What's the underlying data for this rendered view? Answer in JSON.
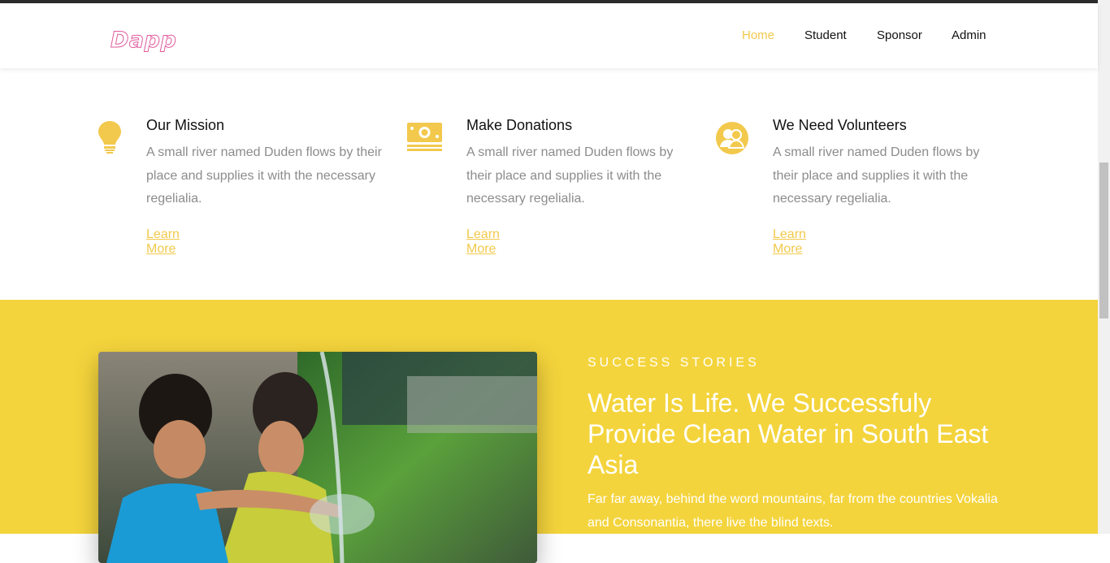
{
  "brand": {
    "logo": "Dapp"
  },
  "nav": {
    "items": [
      "Home",
      "Student",
      "Sponsor",
      "Admin"
    ],
    "active": "Home"
  },
  "colors": {
    "accent": "#f2c94c",
    "yellow_bg": "#f4d43c",
    "logo": "#e05b9d"
  },
  "features": [
    {
      "icon": "lightbulb-icon",
      "title": "Our Mission",
      "text": "A small river named Duden flows by their place and supplies it with the necessary regelialia.",
      "link": "Learn More"
    },
    {
      "icon": "money-icon",
      "title": "Make Donations",
      "text": "A small river named Duden flows by their place and supplies it with the necessary regelialia.",
      "link": "Learn More"
    },
    {
      "icon": "volunteers-icon",
      "title": "We Need Volunteers",
      "text": "A small river named Duden flows by their place and supplies it with the necessary regelialia.",
      "link": "Learn More"
    }
  ],
  "story": {
    "kicker": "SUCCESS STORIES",
    "headline": "Water Is Life. We Successfuly Provide Clean Water in South East Asia",
    "text": "Far far away, behind the word mountains, far from the countries Vokalia and Consonantia, there live the blind texts."
  }
}
